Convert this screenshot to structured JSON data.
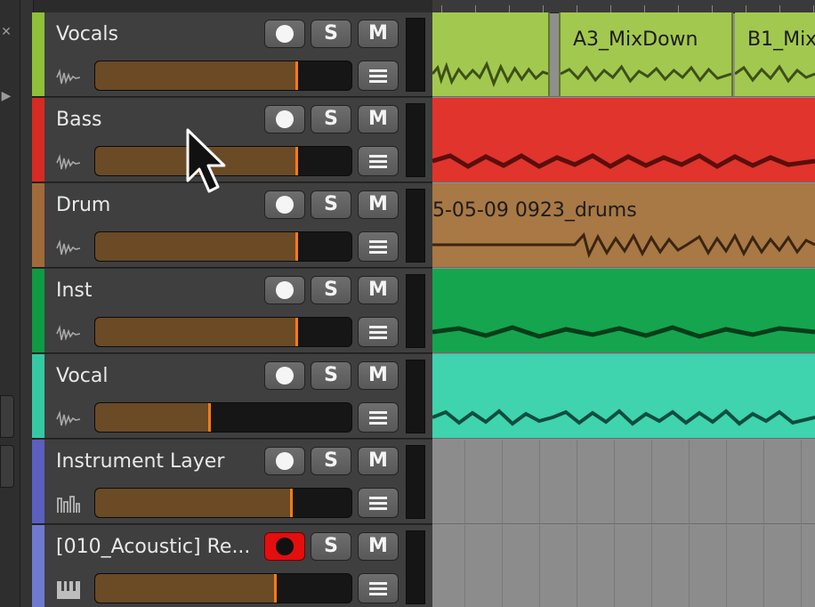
{
  "tracks": [
    {
      "name": "Vocals",
      "color": "#8fc03a",
      "volume": 0.79,
      "type_icon": "audio-waveform-icon",
      "armed": false
    },
    {
      "name": "Bass",
      "color": "#d72a22",
      "volume": 0.79,
      "type_icon": "audio-waveform-icon",
      "armed": false
    },
    {
      "name": "Drum",
      "color": "#a06b38",
      "volume": 0.79,
      "type_icon": "audio-waveform-icon",
      "armed": false
    },
    {
      "name": "Inst",
      "color": "#0f9a44",
      "volume": 0.79,
      "type_icon": "audio-waveform-icon",
      "armed": false
    },
    {
      "name": "Vocal",
      "color": "#35c9a3",
      "volume": 0.45,
      "type_icon": "audio-waveform-icon",
      "armed": false
    },
    {
      "name": "Instrument Layer",
      "color": "#5a5fc0",
      "volume": 0.77,
      "type_icon": "instrument-layer-icon",
      "armed": false
    },
    {
      "name": "[010_Acoustic] Re...",
      "color": "#7079d0",
      "volume": 0.71,
      "type_icon": "piano-icon",
      "armed": true
    }
  ],
  "buttons": {
    "solo": "S",
    "mute": "M"
  },
  "clips": {
    "vocals": [
      {
        "name": "",
        "color": "#a3c84f"
      },
      {
        "name": "A3_MixDown",
        "color": "#a3c84f"
      },
      {
        "name": "B1_Mix",
        "color": "#a3c84f"
      }
    ],
    "bass": {
      "name": "",
      "color": "#e0342c"
    },
    "drum": {
      "name": "5-05-09 0923_drums",
      "color": "#a87845"
    },
    "inst": {
      "name": "",
      "color": "#15a54f"
    },
    "vocal": {
      "name": "",
      "color": "#3fd3ae"
    }
  }
}
